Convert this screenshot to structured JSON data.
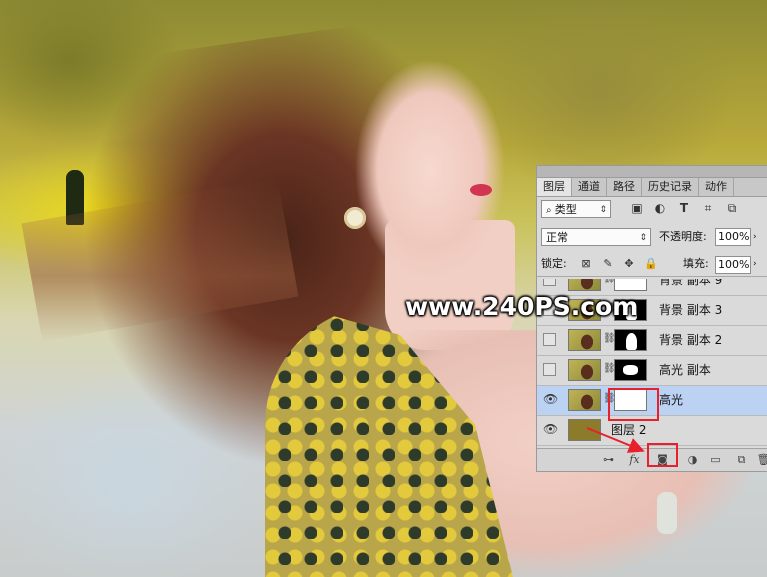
{
  "watermark": "www.240PS.com",
  "panel": {
    "tabs": [
      "图层",
      "通道",
      "路径",
      "历史记录",
      "动作"
    ],
    "active_tab": "图层",
    "filter_kind": "类型",
    "filter_icons": [
      "image-filter-icon",
      "adjustment-filter-icon",
      "type-filter-icon",
      "shape-filter-icon",
      "smart-object-filter-icon"
    ],
    "blend_mode": "正常",
    "opacity_label": "不透明度:",
    "opacity_value": "100%",
    "lock_label": "锁定:",
    "lock_icons": [
      "lock-transparent-icon",
      "lock-image-icon",
      "lock-position-icon",
      "lock-all-icon"
    ],
    "fill_label": "填充:",
    "fill_value": "100%",
    "layers": [
      {
        "name": "背景 副本 9",
        "visible": false,
        "mask": "white"
      },
      {
        "name": "背景 副本 3",
        "visible": false,
        "mask": "silhouette"
      },
      {
        "name": "背景 副本 2",
        "visible": false,
        "mask": "silhouette"
      },
      {
        "name": "高光 副本",
        "visible": false,
        "mask": "blob"
      },
      {
        "name": "高光",
        "visible": true,
        "mask": "white",
        "selected": true
      },
      {
        "name": "图层 2",
        "visible": true,
        "mask": "none"
      }
    ],
    "bottom_icons": [
      "link-layers-icon",
      "fx-icon",
      "add-mask-icon",
      "adjustment-layer-icon",
      "new-group-icon",
      "new-layer-icon",
      "delete-icon"
    ],
    "fx_label": "fx"
  },
  "colors": {
    "highlight": "#e8202c",
    "selected_row": "#bcd2f3",
    "panel_bg": "#dadada"
  }
}
